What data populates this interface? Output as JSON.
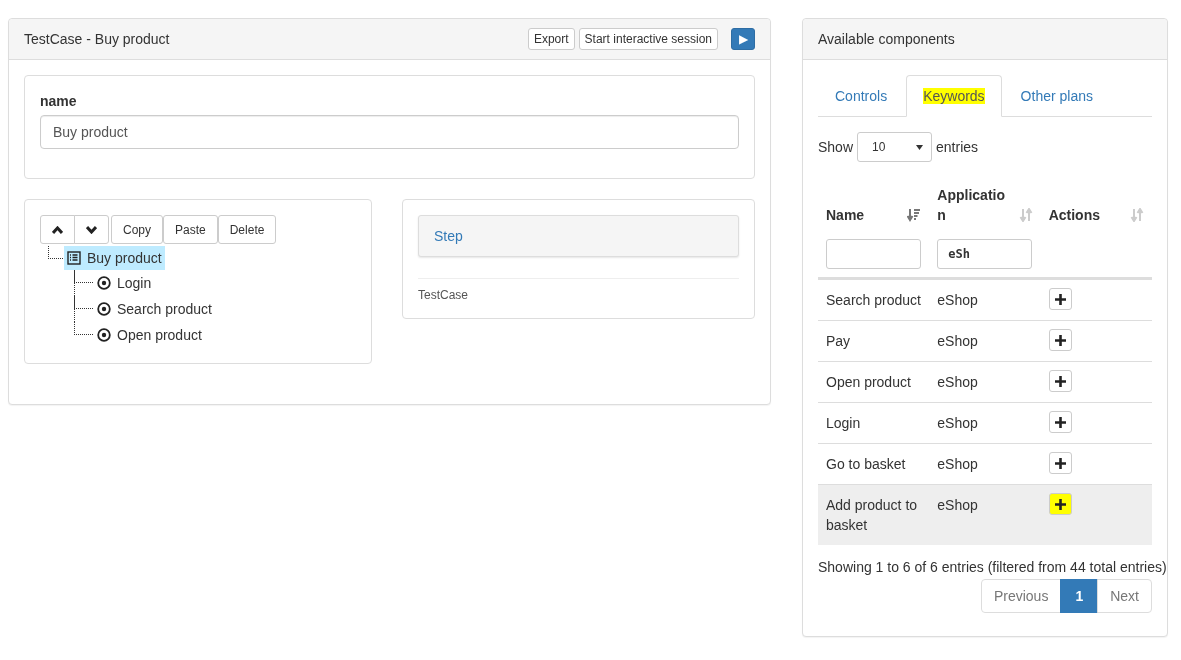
{
  "editor": {
    "title": "TestCase - Buy product",
    "buttons": [
      "Export",
      "Start interactive session"
    ],
    "run_button": {
      "icon": "▶"
    },
    "name_field": {
      "label": "name",
      "value": "Buy product"
    },
    "tree_toolbar": [
      {
        "kind": "up"
      },
      {
        "kind": "down"
      },
      {
        "kind": "text",
        "label": "Copy"
      },
      {
        "kind": "text",
        "label": "Paste"
      },
      {
        "kind": "text",
        "label": "Delete"
      }
    ],
    "tree": [
      {
        "label": "Buy product",
        "kind": "testcase",
        "selected": true,
        "children": [
          {
            "label": "Login",
            "kind": "keyword",
            "selected": false
          },
          {
            "label": "Search product",
            "kind": "keyword",
            "selected": false
          },
          {
            "label": "Open product",
            "kind": "keyword",
            "selected": false
          }
        ]
      }
    ],
    "details": {
      "heading": "Step",
      "type": "TestCase"
    }
  },
  "components": {
    "title": "Available components",
    "tabs": [
      {
        "label": "Controls",
        "selected": false,
        "highlighted": false
      },
      {
        "label": "Keywords",
        "selected": true,
        "highlighted": true
      },
      {
        "label": "Other plans",
        "selected": false,
        "highlighted": false
      }
    ],
    "length": {
      "before": "Show",
      "value": "10",
      "after": "entries"
    },
    "columns": [
      {
        "label": "Name",
        "sorted": true,
        "filter_field": true
      },
      {
        "label": "Applicatio n",
        "sorted": false,
        "filter_field": true,
        "filter": "eSh"
      },
      {
        "label": "Actions",
        "sorted": false,
        "filter_field": false
      }
    ],
    "rows": [
      {
        "name": "Search product",
        "application": "eShop",
        "hovered": false,
        "highlighted": false
      },
      {
        "name": "Pay",
        "application": "eShop",
        "hovered": false,
        "highlighted": false
      },
      {
        "name": "Open product",
        "application": "eShop",
        "hovered": false,
        "highlighted": false
      },
      {
        "name": "Login",
        "application": "eShop",
        "hovered": false,
        "highlighted": false
      },
      {
        "name": "Go to basket",
        "application": "eShop",
        "hovered": false,
        "highlighted": false
      },
      {
        "name": "Add product to basket",
        "application": "eShop",
        "hovered": true,
        "highlighted": true
      }
    ],
    "info": "Showing 1 to 6 of 6 entries (filtered from 44 total entries)",
    "pagination": [
      {
        "label": "Previous",
        "kind": "nav",
        "selected": false
      },
      {
        "label": "1",
        "kind": "page",
        "selected": true
      },
      {
        "label": "Next",
        "kind": "nav",
        "selected": false
      }
    ]
  }
}
